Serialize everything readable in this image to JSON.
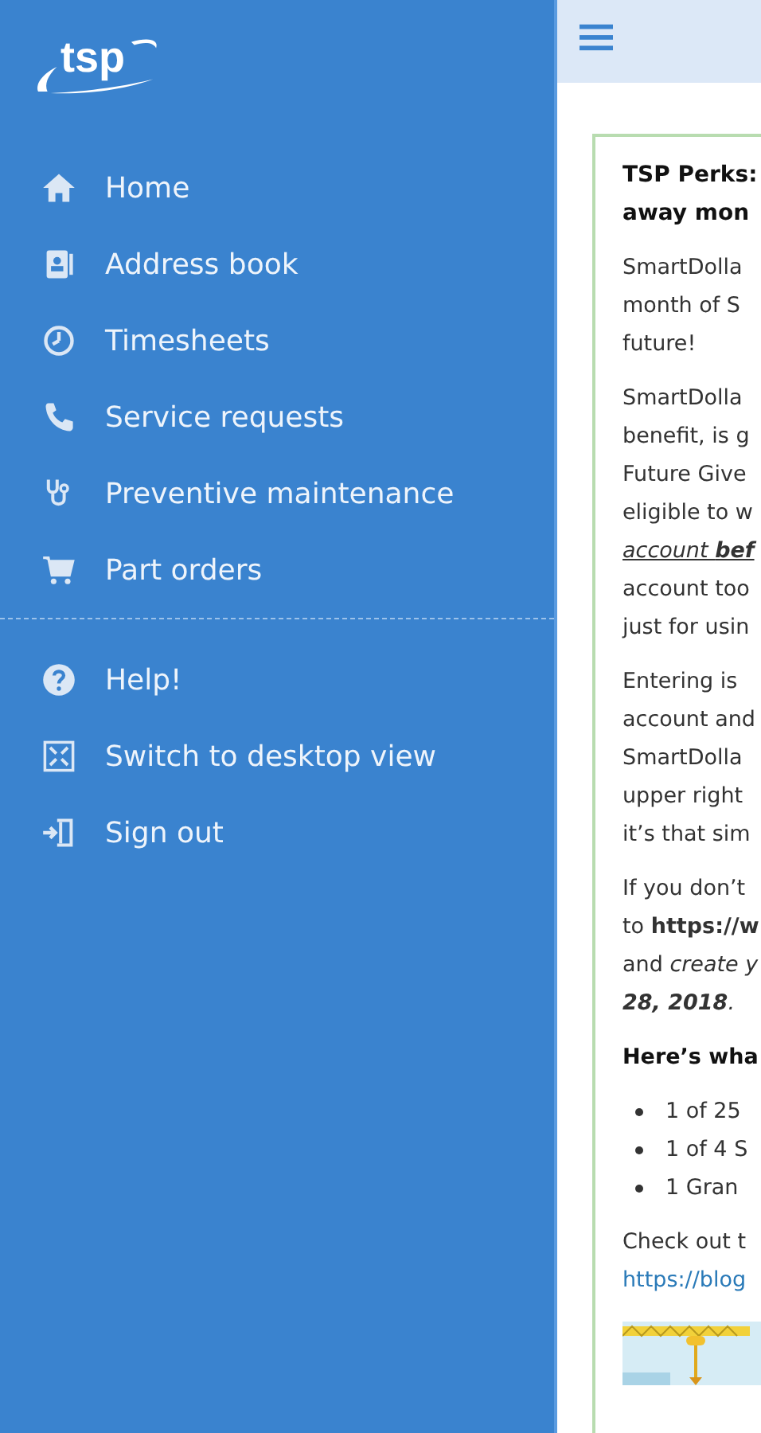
{
  "sidebar": {
    "logo": "tsp",
    "main_items": [
      {
        "label": "Home"
      },
      {
        "label": "Address book"
      },
      {
        "label": "Timesheets"
      },
      {
        "label": "Service requests"
      },
      {
        "label": "Preventive maintenance"
      },
      {
        "label": "Part orders"
      }
    ],
    "other_items": [
      {
        "label": "Help!"
      },
      {
        "label": "Switch to desktop view"
      },
      {
        "label": "Sign out"
      }
    ]
  },
  "article": {
    "title": [
      "TSP Perks:",
      "away mon"
    ],
    "blocks": [
      {
        "kind": "paragraph",
        "lines": [
          {
            "text": "SmartDolla"
          },
          {
            "text": "month of S"
          },
          {
            "text": "future!"
          }
        ]
      },
      {
        "kind": "paragraph",
        "lines": [
          {
            "text": "SmartDolla"
          },
          {
            "text": "benefit, is g"
          },
          {
            "text": "Future Give"
          },
          {
            "text": "eligible to w"
          },
          {
            "text": "account **bef**",
            "kind": "emphasis"
          },
          {
            "text": "account too"
          },
          {
            "text": "just for usin"
          }
        ]
      },
      {
        "kind": "paragraph",
        "lines": [
          {
            "text": "Entering is"
          },
          {
            "text": "account and"
          },
          {
            "text": "SmartDolla"
          },
          {
            "text": "upper right"
          },
          {
            "text": "it’s that sim"
          }
        ]
      },
      {
        "kind": "paragraph",
        "lines": [
          {
            "text": "If you don’t"
          },
          {
            "text": "to **https://w**",
            "kind": "link"
          },
          {
            "text": "and *create y*"
          },
          {
            "text": "**28, 2018**.",
            "kind": "italic"
          }
        ]
      },
      {
        "kind": "heading",
        "lines": [
          {
            "text": "Here’s wha"
          }
        ]
      },
      {
        "kind": "bullets",
        "lines": [
          {
            "text": "1 of 25"
          },
          {
            "text": "1 of 4 S"
          },
          {
            "text": "1 Gran"
          }
        ]
      },
      {
        "kind": "paragraph",
        "lines": [
          {
            "text": "Check out t"
          },
          {
            "text": "https://blog",
            "kind": "url"
          }
        ]
      },
      {
        "kind": "picture"
      }
    ]
  }
}
